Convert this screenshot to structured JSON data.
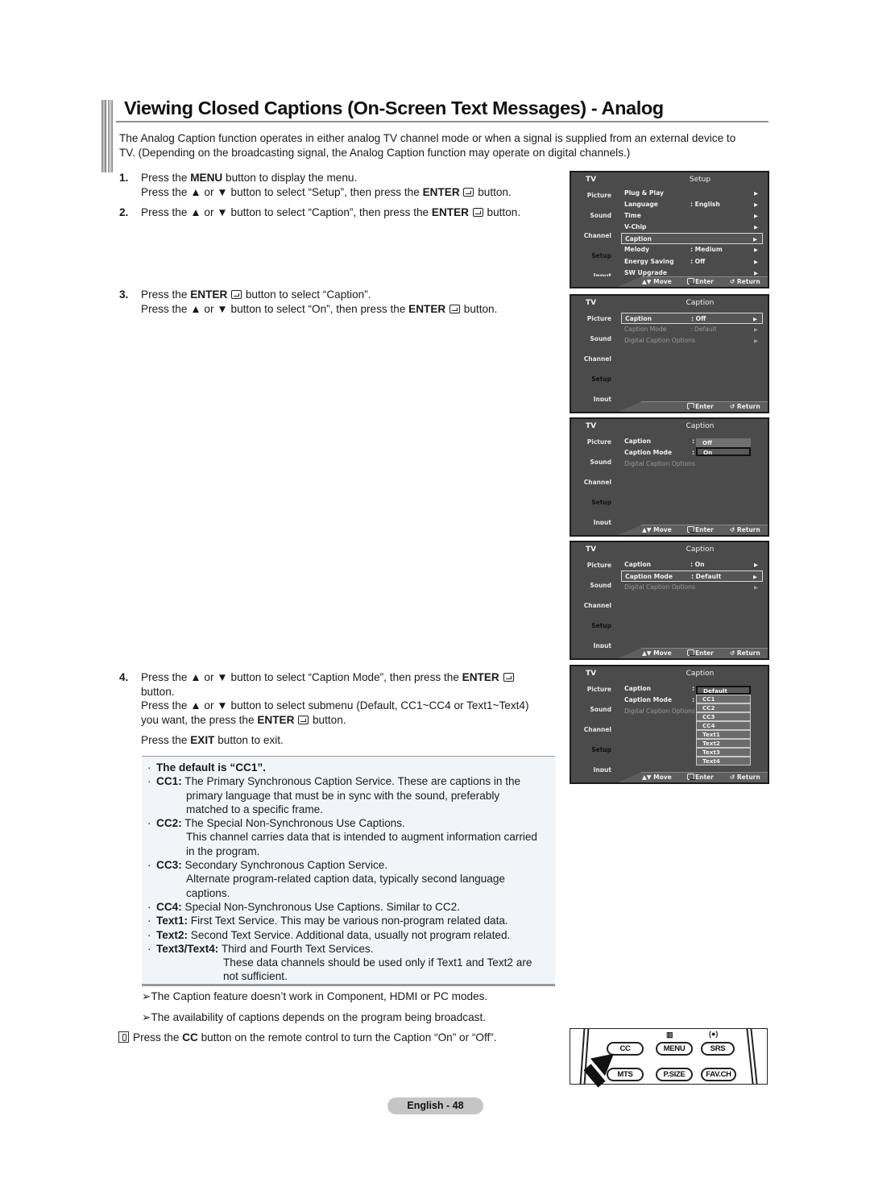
{
  "title": "Viewing Closed Captions (On-Screen Text Messages) - Analog",
  "intro": {
    "line1": "The Analog Caption function operates in either analog TV channel mode or when a signal is supplied from an external device to",
    "line2": "TV. (Depending on the broadcasting signal, the Analog Caption function may operate on digital channels.)"
  },
  "steps": [
    {
      "num": "1.",
      "l1_pre": "Press the ",
      "l1_bold": "MENU",
      "l1_post": " button to display the menu.",
      "l2_pre": "Press the ▲ or ▼ button to select “Setup”, then press the ",
      "l2_bold": "ENTER",
      "l2_post": " button."
    },
    {
      "num": "2.",
      "l1_pre": "Press the ▲ or ▼ button to select “Caption”, then press the ",
      "l1_bold": "ENTER",
      "l1_post": " button."
    },
    {
      "num": "3.",
      "l1_pre": "Press the ",
      "l1_bold": "ENTER",
      "l1_post": " button to select “Caption”.",
      "l2_pre": "Press the ▲ or ▼ button to select “On”, then press the ",
      "l2_bold": "ENTER",
      "l2_post": " button."
    },
    {
      "num": "4.",
      "l1_pre": "Press the ▲ or ▼ button to select “Caption Mode”, then press the ",
      "l1_bold": "ENTER",
      "l1_post": "",
      "l1b": "button.",
      "l2": "Press the ▲ or ▼ button to select submenu (Default, CC1~CC4 or Text1~Text4)",
      "l3_pre": "you want, the press the ",
      "l3_bold": "ENTER",
      "l3_post": " button.",
      "l4_pre": "Press the ",
      "l4_bold": "EXIT",
      "l4_post": " button to exit."
    }
  ],
  "notes": {
    "default": "The default is “CC1”.",
    "items": [
      {
        "key": "CC1:",
        "text": " The Primary Synchronous Caption Service. These are captions in the",
        "more": [
          "primary language that must be in sync with the sound, preferably",
          "matched to a specific frame."
        ]
      },
      {
        "key": "CC2:",
        "text": " The Special Non-Synchronous Use Captions.",
        "more": [
          "This channel carries data that is intended to augment information carried",
          "in the program."
        ]
      },
      {
        "key": "CC3:",
        "text": " Secondary Synchronous Caption Service.",
        "more": [
          "Alternate program-related caption data, typically second language",
          "captions."
        ]
      },
      {
        "key": "CC4:",
        "text": " Special Non-Synchronous Use Captions. Similar to CC2.",
        "more": []
      },
      {
        "key": "Text1:",
        "text": " First Text Service. This may be various non-program related data.",
        "more": []
      },
      {
        "key": "Text2:",
        "text": " Second Text Service. Additional data, usually not program related.",
        "more": []
      },
      {
        "key": "Text3/Text4:",
        "text": " Third and Fourth Text Services.",
        "more2": [
          "These data channels should be used only if Text1 and Text2 are",
          "not sufficient."
        ]
      }
    ]
  },
  "arrow_notes": [
    "➢The Caption feature doesn’t work in Component, HDMI or PC modes.",
    "➢The availability of captions depends on the program being broadcast."
  ],
  "remote_note": {
    "pre": "Press the ",
    "bold": "CC",
    "post": " button on the remote control to turn the Caption “On” or “Off”."
  },
  "osd": {
    "tv": "TV",
    "side": [
      "Picture",
      "Sound",
      "Channel",
      "Setup",
      "Input"
    ],
    "footer": {
      "move": "▲▼ Move",
      "enter": "Enter",
      "return": "↺ Return"
    },
    "screens": [
      {
        "title": "Setup",
        "rows": [
          {
            "label": "Plug & Play",
            "value": "",
            "arrow": "▶"
          },
          {
            "label": "Language",
            "value": ": English",
            "arrow": "▶"
          },
          {
            "label": "Time",
            "value": "",
            "arrow": "▶"
          },
          {
            "label": "V-Chip",
            "value": "",
            "arrow": "▶"
          },
          {
            "label": "Caption",
            "value": "",
            "arrow": "▶",
            "selected": true
          },
          {
            "label": "Melody",
            "value": ": Medium",
            "arrow": "▶"
          },
          {
            "label": "Energy Saving",
            "value": ": Off",
            "arrow": "▶"
          },
          {
            "label": "SW Upgrade",
            "value": "",
            "arrow": "▶"
          }
        ]
      },
      {
        "title": "Caption",
        "rows": [
          {
            "label": "Caption",
            "value": ": Off",
            "arrow": "▶",
            "selected": true
          },
          {
            "label": "Caption Mode",
            "value": ": Default",
            "arrow": "▶",
            "dim": true
          },
          {
            "label": "Digital Caption Options",
            "value": "",
            "arrow": "▶",
            "dim": true
          }
        ]
      },
      {
        "title": "Caption",
        "rows": [
          {
            "label": "Caption",
            "value": ""
          },
          {
            "label": "Caption Mode",
            "value": ""
          },
          {
            "label": "Digital Caption Options",
            "value": "",
            "dim": true
          }
        ],
        "dropdown": [
          "Off",
          "On"
        ],
        "dropdown_selected": "On"
      },
      {
        "title": "Caption",
        "rows": [
          {
            "label": "Caption",
            "value": ": On",
            "arrow": "▶"
          },
          {
            "label": "Caption Mode",
            "value": ": Default",
            "arrow": "▶",
            "selected": true
          },
          {
            "label": "Digital Caption Options",
            "value": "",
            "arrow": "▶",
            "dim": true
          }
        ]
      },
      {
        "title": "Caption",
        "rows": [
          {
            "label": "Caption",
            "value": ""
          },
          {
            "label": "Caption Mode",
            "value": ""
          },
          {
            "label": "Digital Caption Options",
            "value": "",
            "dim": true
          }
        ],
        "dropdown": [
          "Default",
          "CC1",
          "CC2",
          "CC3",
          "CC4",
          "Text1",
          "Text2",
          "Text3",
          "Text4"
        ],
        "dropdown_selected": "Default"
      }
    ]
  },
  "remote": {
    "row1": [
      "CC",
      "MENU",
      "SRS"
    ],
    "row2": [
      "MTS",
      "P.SIZE",
      "FAV.CH"
    ],
    "icons": [
      "▥",
      "(●)"
    ]
  },
  "page_label": "English - 48"
}
